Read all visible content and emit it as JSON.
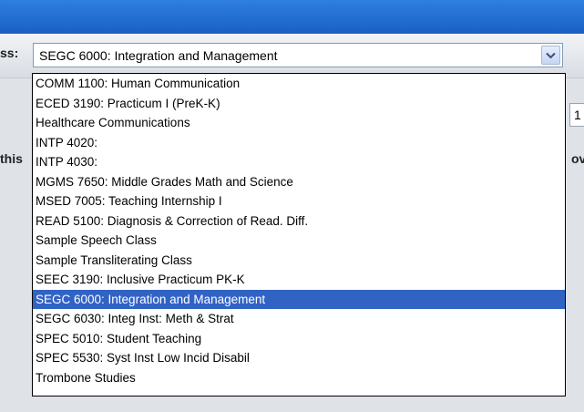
{
  "window": {
    "titlebar_color": "#1f69d4"
  },
  "form": {
    "field_label_fragment": "ss:",
    "selected_value": "SEGC 6000: Integration and Management",
    "left_fragment": "this",
    "right_box_fragment": "1",
    "right_fragment": "ov"
  },
  "dropdown": {
    "selected_index": 11,
    "options": [
      "COMM 1100: Human Communication",
      "ECED 3190: Practicum I (PreK-K)",
      "Healthcare Communications",
      "INTP 4020:",
      "INTP 4030:",
      "MGMS 7650: Middle Grades Math and Science",
      "MSED 7005: Teaching Internship I",
      "READ 5100: Diagnosis & Correction of Read. Diff.",
      "Sample Speech Class",
      "Sample Transliterating Class",
      "SEEC 3190: Inclusive Practicum PK-K",
      "SEGC 6000: Integration and Management",
      "SEGC 6030: Integ Inst: Meth & Strat",
      "SPEC 5010: Student Teaching",
      "SPEC 5530: Syst Inst Low Incid Disabil",
      "Trombone Studies"
    ]
  }
}
